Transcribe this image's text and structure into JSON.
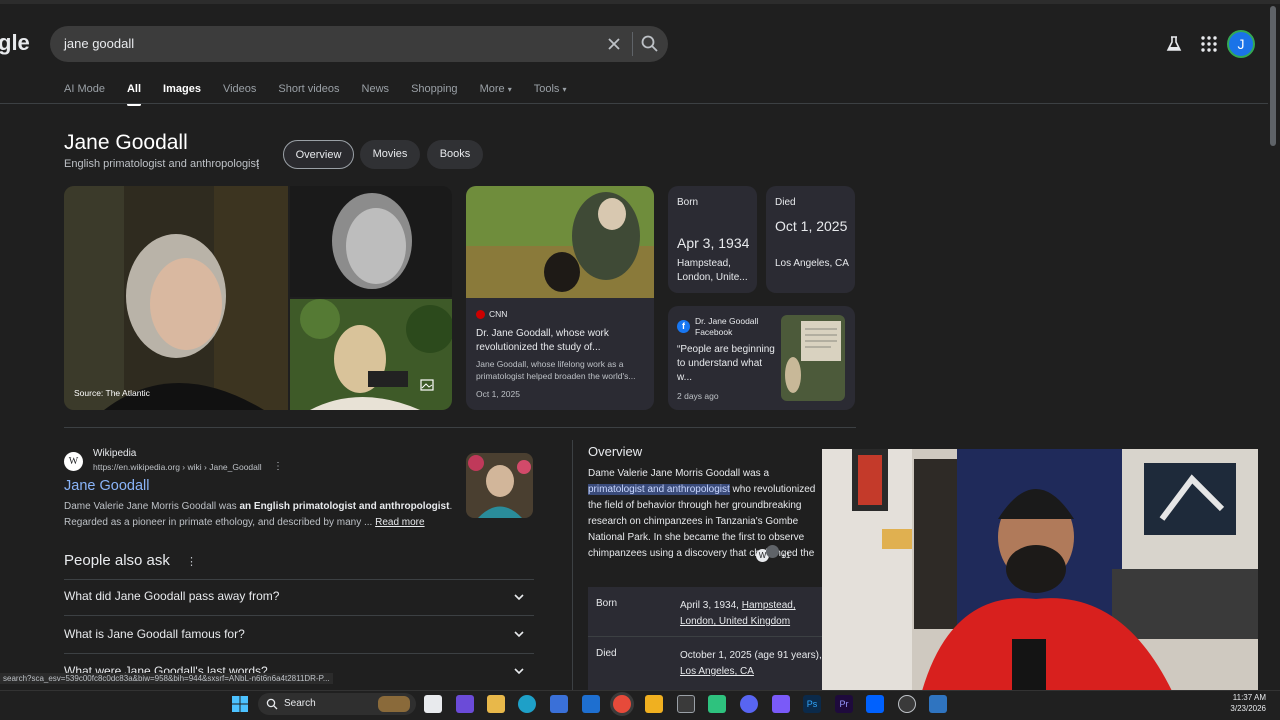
{
  "logo": "gle",
  "search": {
    "query": "jane goodall"
  },
  "tabs": [
    {
      "label": "AI Mode"
    },
    {
      "label": "All"
    },
    {
      "label": "Images"
    },
    {
      "label": "Videos"
    },
    {
      "label": "Short videos"
    },
    {
      "label": "News"
    },
    {
      "label": "Shopping"
    },
    {
      "label": "More"
    },
    {
      "label": "Tools"
    }
  ],
  "avatar_letter": "J",
  "knowledge": {
    "title": "Jane Goodall",
    "subtitle": "English primatologist and anthropologist",
    "pills": [
      "Overview",
      "Movies",
      "Books"
    ],
    "image_source": "Source: The Atlantic",
    "news": {
      "source": "CNN",
      "headline": "Dr. Jane Goodall, whose work revolutionized the study of...",
      "snippet": "Jane Goodall, whose lifelong work as a primatologist helped broaden the world's...",
      "date": "Oct 1, 2025"
    },
    "born": {
      "label": "Born",
      "date": "Apr 3, 1934",
      "place": "Hampstead, London, Unite..."
    },
    "died": {
      "label": "Died",
      "date": "Oct 1, 2025",
      "place": "Los Angeles, CA"
    },
    "social": {
      "name": "Dr. Jane Goodall",
      "platform": "Facebook",
      "quote": "“People are beginning to understand what w...",
      "time": "2 days ago"
    }
  },
  "result": {
    "site": "Wikipedia",
    "url": "https://en.wikipedia.org › wiki › Jane_Goodall",
    "title": "Jane Goodall",
    "snippet_a": "Dame Valerie Jane Morris Goodall was ",
    "snippet_b": "an English primatologist and anthropologist",
    "snippet_c": ". Regarded as a pioneer in primate ethology, and described by many ... ",
    "read_more": "Read more"
  },
  "paa": {
    "title": "People also ask",
    "questions": [
      "What did Jane Goodall pass away from?",
      "What is Jane Goodall famous for?",
      "What were Jane Goodall's last words?"
    ]
  },
  "overview": {
    "title": "Overview",
    "text_a": "Dame Valerie Jane Morris Goodall was a ",
    "text_hl": "primatologist and anthropologist",
    "text_b": " who revolutionized the field of behavior through her groundbreaking research on chimpanzees in Tanzania's Gombe National Park. In she became the first to observe chimpanzees using a discovery that challenged the ide",
    "plus": "+1",
    "rows": [
      {
        "label": "Born",
        "value": "April 3, 1934, ",
        "link": "Hampstead, London, United Kingdom"
      },
      {
        "label": "Died",
        "value": "October 1, 2025 (age 91 years), ",
        "link": "Los Angeles, CA"
      }
    ]
  },
  "status_url": "search?sca_esv=539c00fc8c0dc83a&biw=958&bih=944&sxsrf=ANbL-n6t6n6a4t2811DR-P...",
  "taskbar": {
    "search": "Search",
    "time": "11:37 AM",
    "date": "3/23/2026"
  }
}
